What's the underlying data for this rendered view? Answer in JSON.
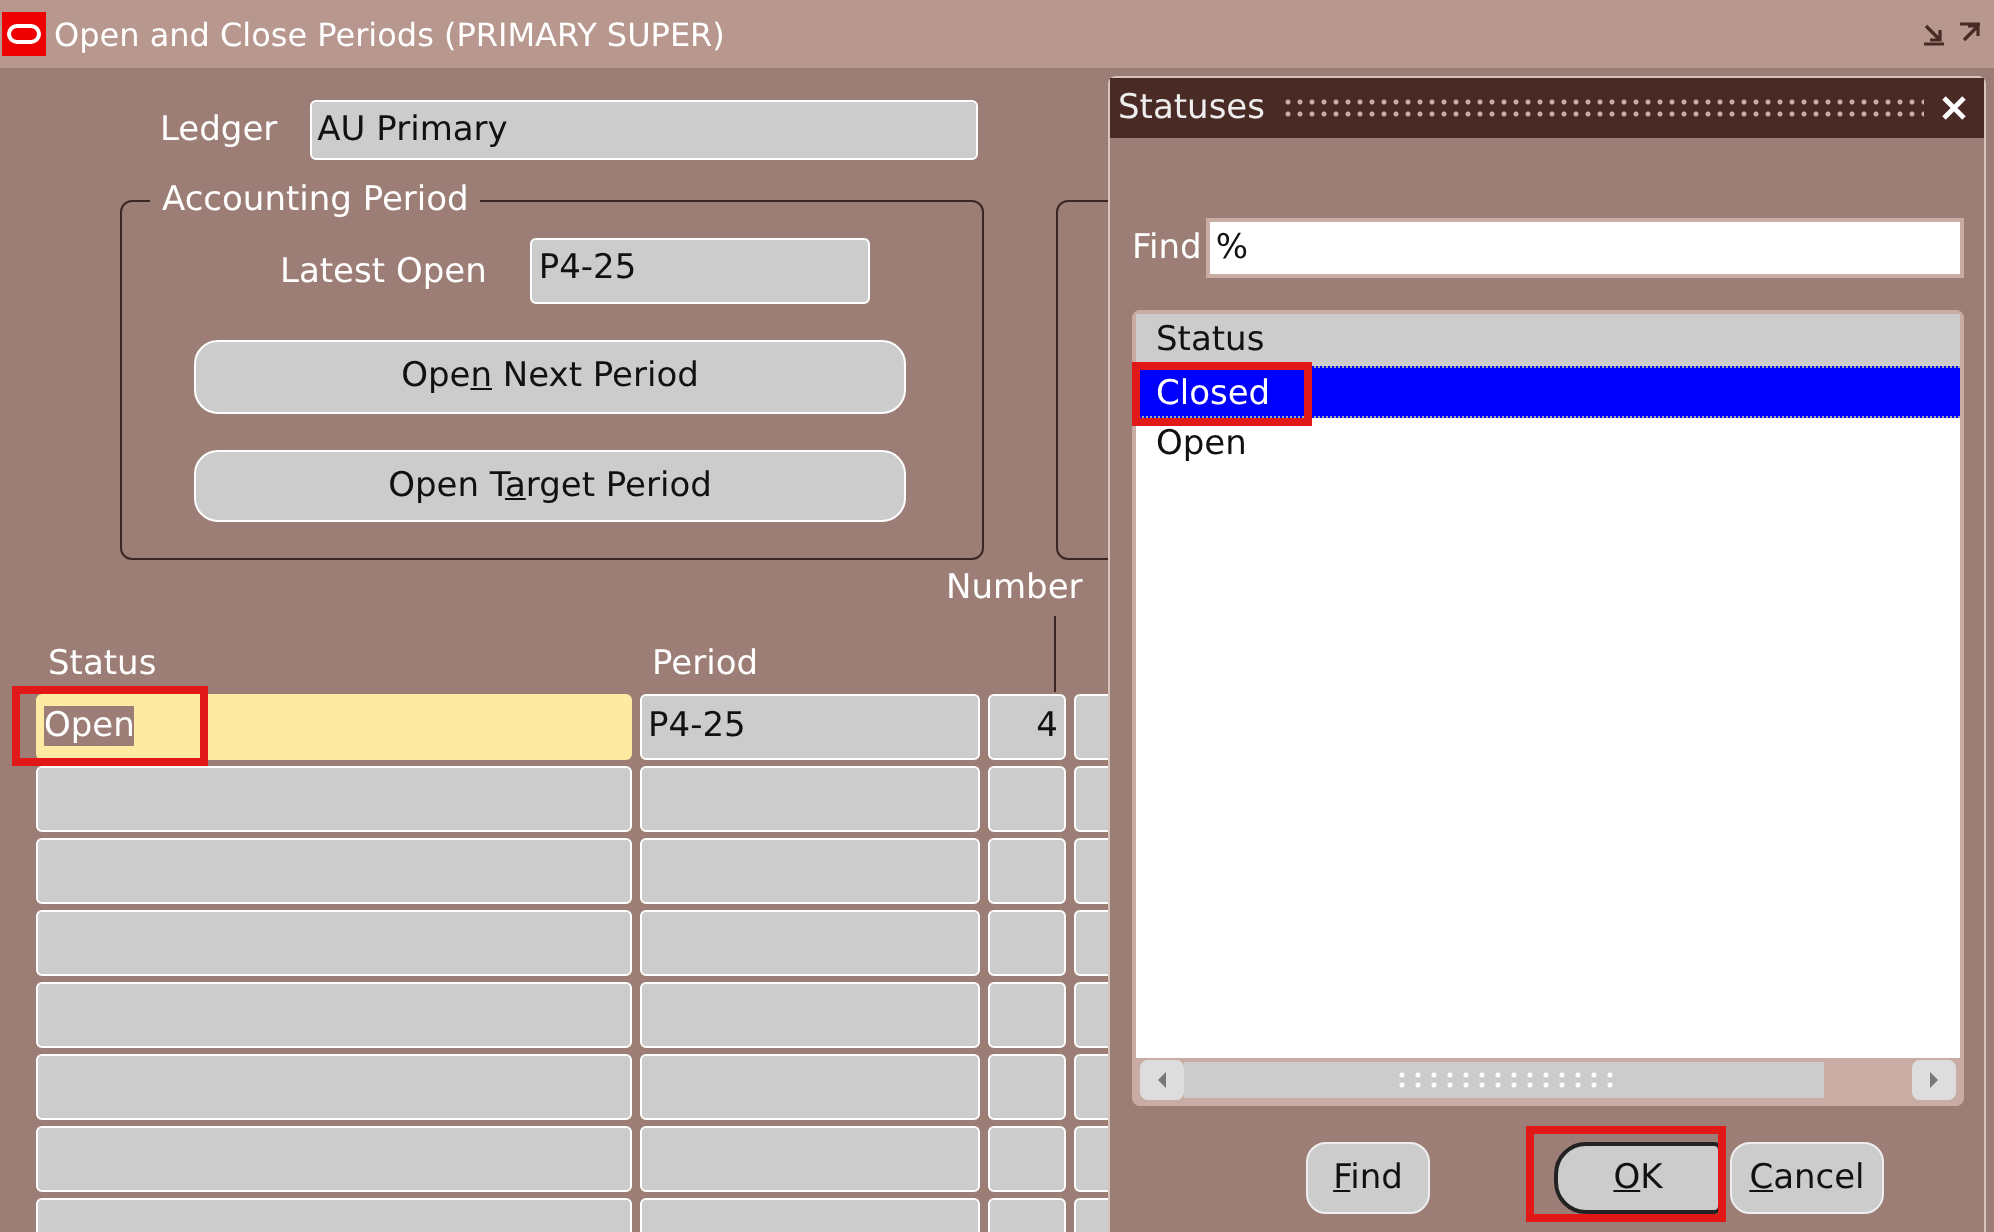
{
  "window": {
    "title": "Open and Close Periods (PRIMARY SUPER)"
  },
  "ledger": {
    "label": "Ledger",
    "value": "AU Primary"
  },
  "accounting_period": {
    "title": "Accounting Period",
    "latest_open_label": "Latest Open",
    "latest_open_value": "P4-25",
    "buttons": [
      {
        "before": "Ope",
        "key": "n",
        "after": " Next Period"
      },
      {
        "before": "Open T",
        "key": "a",
        "after": "rget Period"
      }
    ]
  },
  "table": {
    "group_header": "Number",
    "columns": [
      "Status",
      "Period"
    ],
    "rows": [
      {
        "cells": [
          "Open",
          "P4-25",
          "4"
        ],
        "highlighted": true,
        "current": true
      },
      {
        "cells": [
          "",
          "",
          ""
        ],
        "highlighted": false,
        "current": false
      },
      {
        "cells": [
          "",
          "",
          ""
        ],
        "highlighted": false,
        "current": false
      },
      {
        "cells": [
          "",
          "",
          ""
        ],
        "highlighted": false,
        "current": false
      },
      {
        "cells": [
          "",
          "",
          ""
        ],
        "highlighted": false,
        "current": false
      },
      {
        "cells": [
          "",
          "",
          ""
        ],
        "highlighted": false,
        "current": false
      },
      {
        "cells": [
          "",
          "",
          ""
        ],
        "highlighted": false,
        "current": false
      },
      {
        "cells": [
          "",
          "",
          ""
        ],
        "highlighted": false,
        "current": false
      }
    ]
  },
  "dialog": {
    "title": "Statuses",
    "find_label": "Find",
    "find_value": "%",
    "list_header": "Status",
    "items": [
      {
        "label": "Closed",
        "selected": true,
        "highlighted": true
      },
      {
        "label": "Open",
        "selected": false,
        "highlighted": false
      }
    ],
    "buttons": [
      {
        "key": "F",
        "after": "ind",
        "highlighted": false,
        "focused": false
      },
      {
        "key": "O",
        "after": "K",
        "highlighted": true,
        "focused": true
      },
      {
        "key": "C",
        "after": "ancel",
        "highlighted": false,
        "focused": false
      }
    ]
  }
}
